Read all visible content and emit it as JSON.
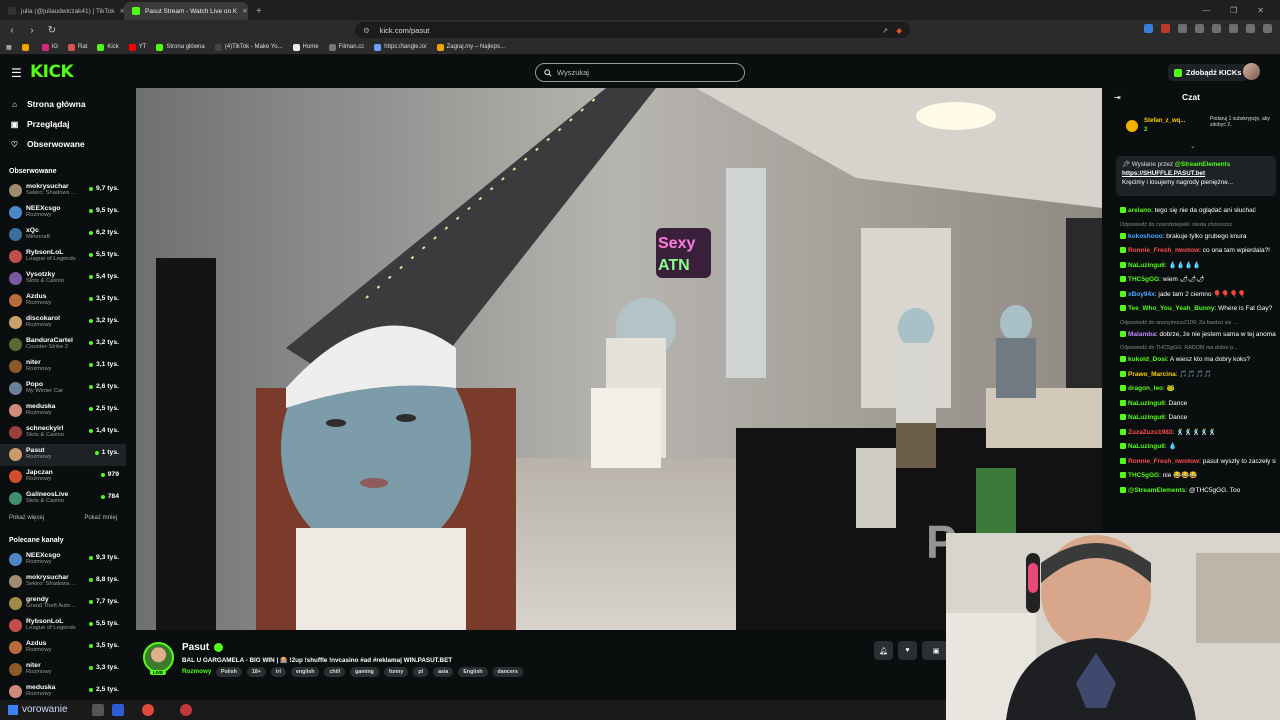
{
  "browser": {
    "tabs": [
      {
        "label": "julia (@juliaudwiczak41) | TikTok",
        "active": false,
        "favicon_color": "#222222"
      },
      {
        "label": "Pasut Stream - Watch Live on K",
        "active": true,
        "favicon_color": "#53fc18"
      }
    ],
    "url": "kick.com/pasut",
    "bookmarks": [
      {
        "label": "",
        "color": "#f4a400"
      },
      {
        "label": "IG",
        "color": "#d62976"
      },
      {
        "label": "Rat",
        "color": "#d9534f"
      },
      {
        "label": "Kick",
        "color": "#53fc18"
      },
      {
        "label": "YT",
        "color": "#ff0000"
      },
      {
        "label": "Strona główna",
        "color": "#53fc18"
      },
      {
        "label": "(4)TikTok - Make Yo...",
        "color": "#222222"
      },
      {
        "label": "Home",
        "color": "#ffffff"
      },
      {
        "label": "Filman.cc",
        "color": "#777777"
      },
      {
        "label": "https://tangle.io/",
        "color": "#6aa0ff"
      },
      {
        "label": "Zagraj.my – Najleps...",
        "color": "#f4a400"
      }
    ]
  },
  "header": {
    "logo": "KICK",
    "search_placeholder": "Wyszukaj",
    "get_kicks": "Zdobądź KICKs"
  },
  "sidebar": {
    "nav": [
      {
        "label": "Strona główna",
        "icon": "home-icon"
      },
      {
        "label": "Przeglądaj",
        "icon": "browse-icon"
      },
      {
        "label": "Obserwowane",
        "icon": "heart-icon"
      }
    ],
    "followed_title": "Obserwowane",
    "followed": [
      {
        "name": "mokrysuchar",
        "category": "Sekiro: Shadows ...",
        "viewers": "9,7 tys.",
        "color": "#a08a70"
      },
      {
        "name": "NEEXcsgo",
        "category": "Rozmowy",
        "viewers": "9,5 tys.",
        "color": "#4f86c6"
      },
      {
        "name": "xQc",
        "category": "Minecraft",
        "viewers": "6,2 tys.",
        "color": "#3a6e9e"
      },
      {
        "name": "RybsonLoL",
        "category": "League of Legends",
        "viewers": "5,5 tys.",
        "color": "#c24d4d"
      },
      {
        "name": "Vysotzky",
        "category": "Slots & Casino",
        "viewers": "5,4 tys.",
        "color": "#7a5a9e"
      },
      {
        "name": "Azdus",
        "category": "Rozmowy",
        "viewers": "3,5 tys.",
        "color": "#b86b3c"
      },
      {
        "name": "discokarol",
        "category": "Rozmowy",
        "viewers": "3,2 tys.",
        "color": "#c9a26b"
      },
      {
        "name": "BanduraCartel",
        "category": "Counter-Strike 2",
        "viewers": "3,2 tys.",
        "color": "#556b2f"
      },
      {
        "name": "niter",
        "category": "Rozmowy",
        "viewers": "3,1 tys.",
        "color": "#8b5a2b"
      },
      {
        "name": "Popo",
        "category": "My Winter Car",
        "viewers": "2,6 tys.",
        "color": "#6a7f99"
      },
      {
        "name": "meduska",
        "category": "Rozmowy",
        "viewers": "2,5 tys.",
        "color": "#d08a7a"
      },
      {
        "name": "schneckyirl",
        "category": "Slots & Casino",
        "viewers": "1,4 tys.",
        "color": "#9a4040"
      },
      {
        "name": "Pasut",
        "category": "Rozmowy",
        "viewers": "1 tys.",
        "color": "#c99a6b",
        "selected": true
      },
      {
        "name": "Japczan",
        "category": "Rozmowy",
        "viewers": "979",
        "color": "#d24d2f"
      },
      {
        "name": "GalineosLive",
        "category": "Slots & Casino",
        "viewers": "784",
        "color": "#3f8f6e"
      }
    ],
    "show_more": "Pokaż więcej",
    "show_less": "Pokaż mniej",
    "recommended_title": "Polecane kanały",
    "recommended": [
      {
        "name": "NEEXcsgo",
        "category": "Rozmowy",
        "viewers": "9,3 tys.",
        "color": "#4f86c6"
      },
      {
        "name": "mokrysuchar",
        "category": "Sekiro: Shadows ...",
        "viewers": "8,8 tys.",
        "color": "#a08a70"
      },
      {
        "name": "grendy",
        "category": "Grand Theft Auto ...",
        "viewers": "7,7 tys.",
        "color": "#9e8b4a"
      },
      {
        "name": "RybsonLoL",
        "category": "League of Legends",
        "viewers": "5,5 tys.",
        "color": "#c24d4d"
      },
      {
        "name": "Azdus",
        "category": "Rozmowy",
        "viewers": "3,5 tys.",
        "color": "#b86b3c"
      },
      {
        "name": "niter",
        "category": "Rozmowy",
        "viewers": "3,3 tys.",
        "color": "#8b5a2b"
      },
      {
        "name": "meduska",
        "category": "Rozmowy",
        "viewers": "2,5 tys.",
        "color": "#d08a7a"
      }
    ]
  },
  "stream": {
    "streamer": "Pasut",
    "title": "BAL U GARGAMELA - BIG WIN | 🎰 !2up !shuffle !nvcasino #ad #reklama| WIN.PASUT.BET",
    "category": "Rozmowy",
    "tags": [
      "Polish",
      "18+",
      "irl",
      "english",
      "chill",
      "gaming",
      "funny",
      "pl",
      "asia",
      "English",
      "dancers"
    ],
    "live_label": "LIVE"
  },
  "chat": {
    "title": "Czat",
    "gift": {
      "user": "Stefan_z_wq...",
      "count": "2",
      "text": "Podaruj 1 subskrypcję, aby zdobyć 2."
    },
    "pinned": {
      "header_prefix": "Wysłane przez",
      "header_user": "@StreamElements",
      "link": "https://SHUFFLE.PASUT.bet",
      "text": "Kręcimy i losujemy nagrody pieniężne..."
    },
    "messages": [
      {
        "reply": "",
        "user": "arelano",
        "color": "#53fc18",
        "text": "tego się nie da oglądać ani słuchać"
      },
      {
        "reply": "Odpowiedź do czarodziejwiki: niezła choroszcz",
        "user": "",
        "color": "",
        "text": ""
      },
      {
        "reply": "",
        "user": "kokoshooo",
        "color": "#4aa8ff",
        "text": "brakuje tylko grubego knura"
      },
      {
        "reply": "",
        "user": "Ronnie_Fresh_nwotow",
        "color": "#ff4d4d",
        "text": "co ona tam wpierdala?!"
      },
      {
        "reply": "",
        "user": "NaLuzingu6",
        "color": "#53fc18",
        "text": "💧💧💧💧"
      },
      {
        "reply": "",
        "user": "THC5gGG",
        "color": "#53fc18",
        "text": "wiem 🌶🌶🌶"
      },
      {
        "reply": "",
        "user": "xBoy94x",
        "color": "#4aa8ff",
        "text": "jade tam 2 ciemno 🎈🎈🎈🎈"
      },
      {
        "reply": "",
        "user": "Tee_Who_You_Yeah_Bunny",
        "color": "#53fc18",
        "text": "Where is Fat Gay?"
      },
      {
        "reply": "Odpowiedź do anonymous2109: Za bardzo się ...",
        "user": "",
        "color": "",
        "text": ""
      },
      {
        "reply": "",
        "user": "Malamba",
        "color": "#c084fc",
        "text": "dobrze, że nie jestem sama w tej anomalii 🎈"
      },
      {
        "reply": "Odpowiedź do THC5gGG: RADOM ma dobre p...",
        "user": "",
        "color": "",
        "text": ""
      },
      {
        "reply": "",
        "user": "kukold_Dosi",
        "color": "#53fc18",
        "text": "A wiesz kto ma dobry koks?"
      },
      {
        "reply": "",
        "user": "Prawo_Marcina",
        "color": "#f6d100",
        "text": "🎵🎵🎵🎵"
      },
      {
        "reply": "",
        "user": "dragon_leo",
        "color": "#53fc18",
        "text": "🐸"
      },
      {
        "reply": "",
        "user": "NaLuzingu6",
        "color": "#53fc18",
        "text": "Dance"
      },
      {
        "reply": "",
        "user": "NaLuzingu6",
        "color": "#53fc18",
        "text": "Dance"
      },
      {
        "reply": "",
        "user": "ZuzaZuzu1983",
        "color": "#ff4d4d",
        "text": "🕺🕺🕺🕺🕺"
      },
      {
        "reply": "",
        "user": "NaLuzingu6",
        "color": "#53fc18",
        "text": "💧"
      },
      {
        "reply": "",
        "user": "Ronnie_Fresh_nwotow",
        "color": "#ff4d4d",
        "text": "pasut wyszły to zaczeły sie opierdalac"
      },
      {
        "reply": "",
        "user": "THC5gGG",
        "color": "#53fc18",
        "text": "nie 😂😂😂"
      },
      {
        "reply": "",
        "user": "@StreamElements",
        "color": "#53fc18",
        "text": "@THC5gGG. Too"
      }
    ]
  },
  "taskbar": {
    "search_text": "vorowanie"
  }
}
